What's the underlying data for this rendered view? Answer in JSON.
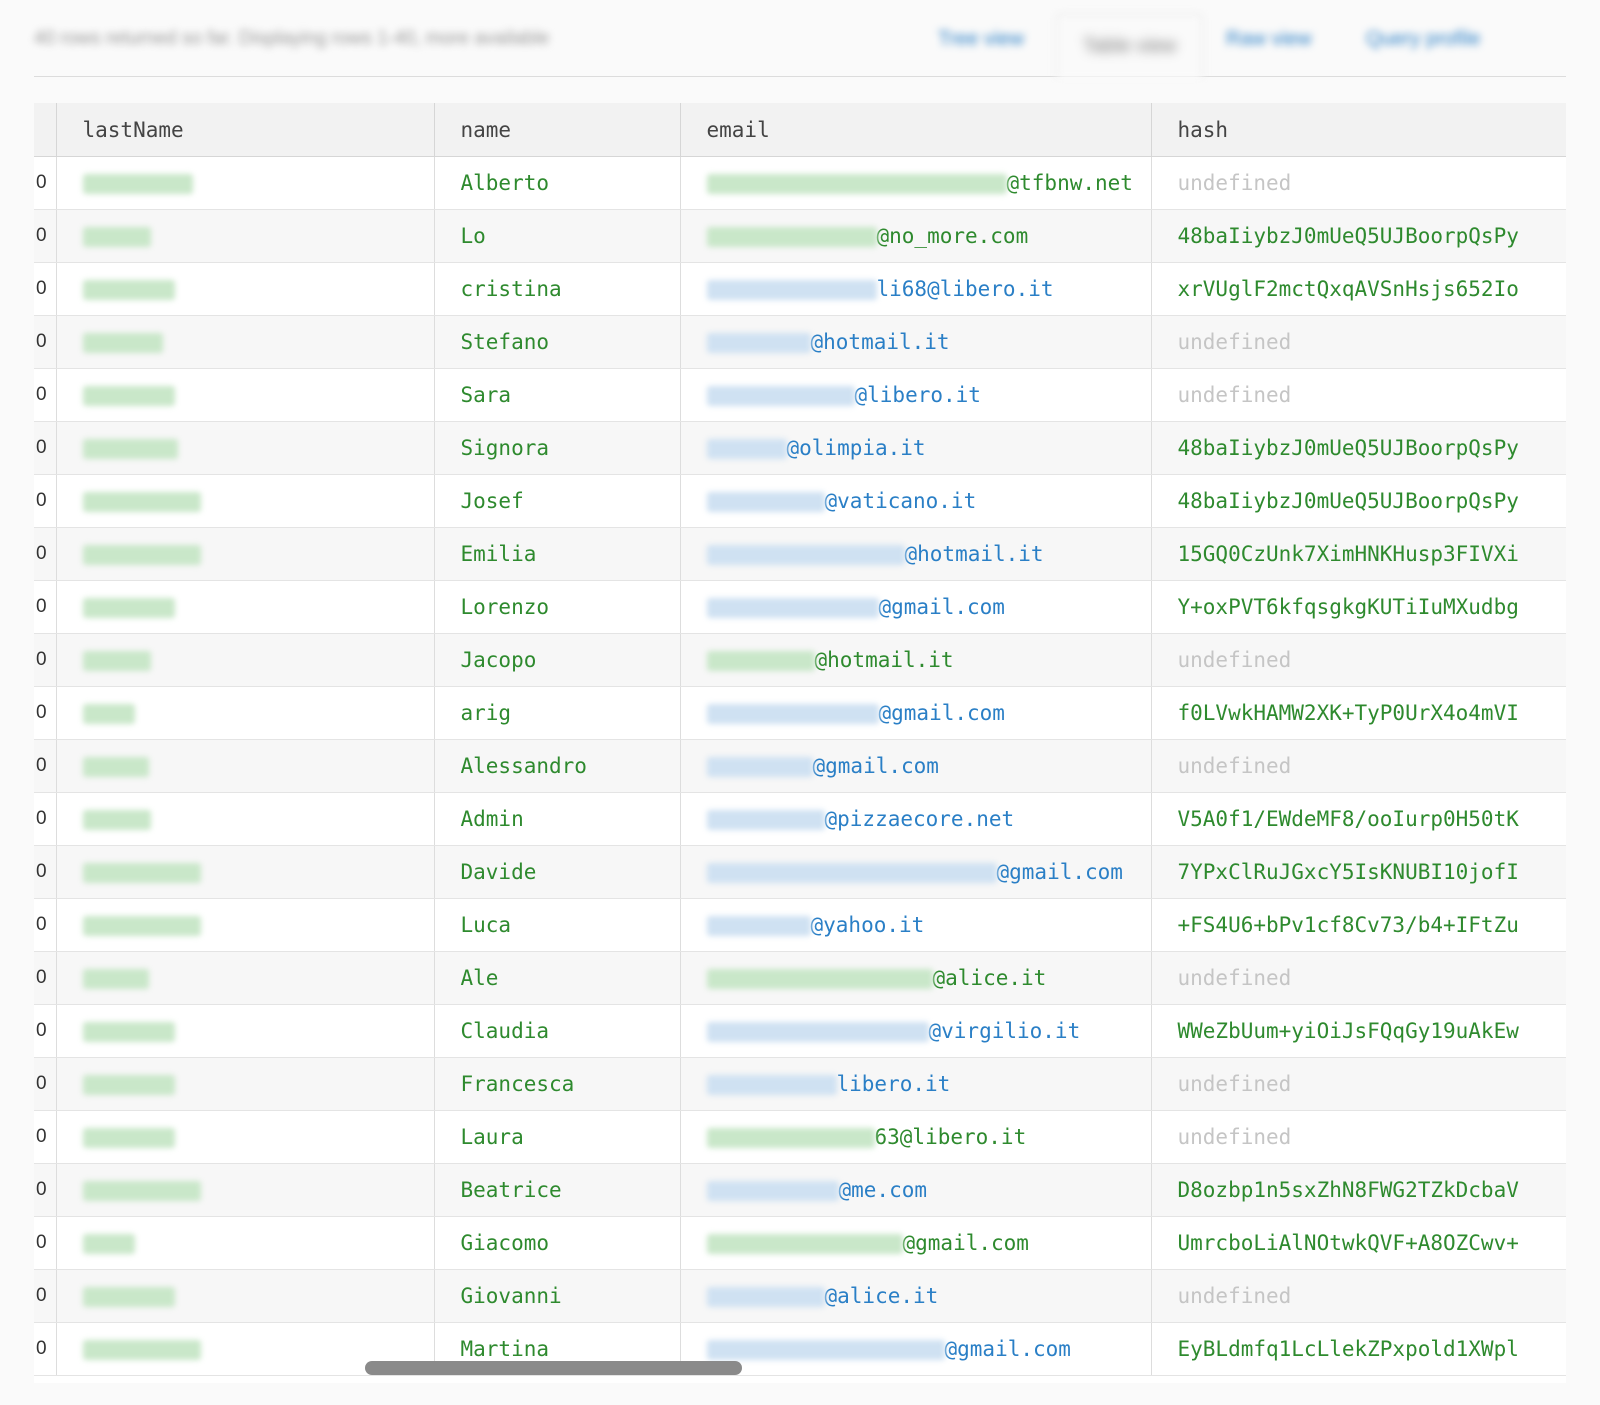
{
  "header": {
    "status_text": "40 rows returned so far. Displaying rows 1-40, more available",
    "tabs": [
      "Tree view",
      "Table view",
      "Raw view",
      "Query profile"
    ]
  },
  "table": {
    "columns": [
      "lastName",
      "name",
      "email",
      "hash"
    ],
    "rows": [
      {
        "idx": "0",
        "name": "Alberto",
        "email_domain": "@tfbnw.net",
        "hash": "undefined"
      },
      {
        "idx": "0",
        "name": "Lo",
        "email_domain": "@no_more.com",
        "hash": "48baIiybzJ0mUeQ5UJBoorpQsPy"
      },
      {
        "idx": "0",
        "name": "cristina",
        "email_domain": "li68@libero.it",
        "hash": "xrVUglF2mctQxqAVSnHsjs652Io"
      },
      {
        "idx": "0",
        "name": "Stefano",
        "email_domain": "@hotmail.it",
        "hash": "undefined"
      },
      {
        "idx": "0",
        "name": "Sara",
        "email_domain": "@libero.it",
        "hash": "undefined"
      },
      {
        "idx": "0",
        "name": "Signora",
        "email_domain": "@olimpia.it",
        "hash": "48baIiybzJ0mUeQ5UJBoorpQsPy"
      },
      {
        "idx": "0",
        "name": "Josef",
        "email_domain": "@vaticano.it",
        "hash": "48baIiybzJ0mUeQ5UJBoorpQsPy"
      },
      {
        "idx": "0",
        "name": "Emilia",
        "email_domain": "@hotmail.it",
        "hash": "15GQ0CzUnk7XimHNKHusp3FIVXi"
      },
      {
        "idx": "0",
        "name": "Lorenzo",
        "email_domain": "@gmail.com",
        "hash": "Y+oxPVT6kfqsgkgKUTiIuMXudbg"
      },
      {
        "idx": "0",
        "name": "Jacopo",
        "email_domain": "@hotmail.it",
        "hash": "undefined"
      },
      {
        "idx": "0",
        "name": "arig",
        "email_domain": "@gmail.com",
        "hash": "f0LVwkHAMW2XK+TyP0UrX4o4mVI"
      },
      {
        "idx": "0",
        "name": "Alessandro",
        "email_domain": "@gmail.com",
        "hash": "undefined"
      },
      {
        "idx": "0",
        "name": "Admin",
        "email_domain": "@pizzaecore.net",
        "hash": "V5A0f1/EWdeMF8/ooIurp0H50tK"
      },
      {
        "idx": "0",
        "name": "Davide",
        "email_domain": "@gmail.com",
        "hash": "7YPxClRuJGxcY5IsKNUBI10jofI"
      },
      {
        "idx": "0",
        "name": "Luca",
        "email_domain": "@yahoo.it",
        "hash": "+FS4U6+bPv1cf8Cv73/b4+IFtZu"
      },
      {
        "idx": "0",
        "name": "Ale",
        "email_domain": "@alice.it",
        "hash": "undefined"
      },
      {
        "idx": "0",
        "name": "Claudia",
        "email_domain": "@virgilio.it",
        "hash": "WWeZbUum+yiOiJsFQqGy19uAkEw"
      },
      {
        "idx": "0",
        "name": "Francesca",
        "email_domain": "libero.it",
        "hash": "undefined"
      },
      {
        "idx": "0",
        "name": "Laura",
        "email_domain": "63@libero.it",
        "hash": "undefined"
      },
      {
        "idx": "0",
        "name": "Beatrice",
        "email_domain": "@me.com",
        "hash": "D8ozbp1n5sxZhN8FWG2TZkDcbaV"
      },
      {
        "idx": "0",
        "name": "Giacomo",
        "email_domain": "@gmail.com",
        "hash": "UmrcboLiAlNOtwkQVF+A8OZCwv+"
      },
      {
        "idx": "0",
        "name": "Giovanni",
        "email_domain": "@alice.it",
        "hash": "undefined"
      },
      {
        "idx": "0",
        "name": "Martina",
        "email_domain": "@gmail.com",
        "hash": "EyBLdmfq1LcLlekZPxpold1XWpl"
      }
    ]
  },
  "colors": {
    "value_green": "#2e8a2e",
    "link_blue": "#2a7fc6",
    "undefined_gray": "#c5c5c5",
    "header_bg": "#f2f2f2"
  }
}
